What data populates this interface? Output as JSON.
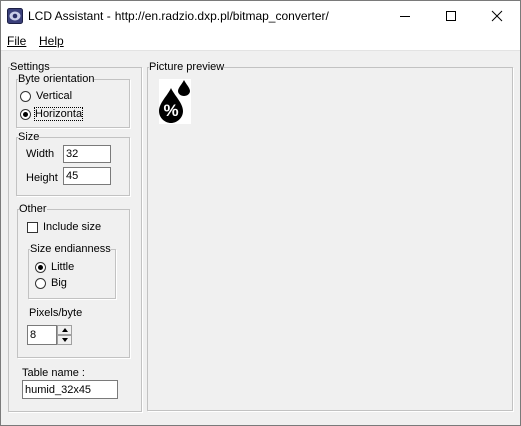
{
  "window": {
    "title": "LCD Assistant -",
    "url": "http://en.radzio.dxp.pl/bitmap_converter/"
  },
  "menu": {
    "file": "File",
    "help": "Help"
  },
  "settings": {
    "title": "Settings",
    "byte_orientation": {
      "title": "Byte orientation",
      "vertical": "Vertical",
      "horizontal": "Horizonta",
      "selected": "horizontal"
    },
    "size": {
      "title": "Size",
      "width_label": "Width",
      "width_value": "32",
      "height_label": "Height",
      "height_value": "45"
    },
    "other": {
      "title": "Other",
      "include_size": "Include size",
      "include_size_checked": false,
      "endianness": {
        "title": "Size endianness",
        "little": "Little",
        "big": "Big",
        "selected": "little"
      },
      "pixels_per_byte_label": "Pixels/byte",
      "pixels_per_byte_value": "8"
    },
    "table_name_label": "Table name :",
    "table_name_value": "humid_32x45"
  },
  "preview": {
    "title": "Picture preview",
    "symbol": "%",
    "icon": "humidity-drops-icon"
  },
  "colors": {
    "window_bg": "#f0f0f0",
    "titlebar_bg": "#ffffff",
    "border": "#7a7a7a"
  }
}
